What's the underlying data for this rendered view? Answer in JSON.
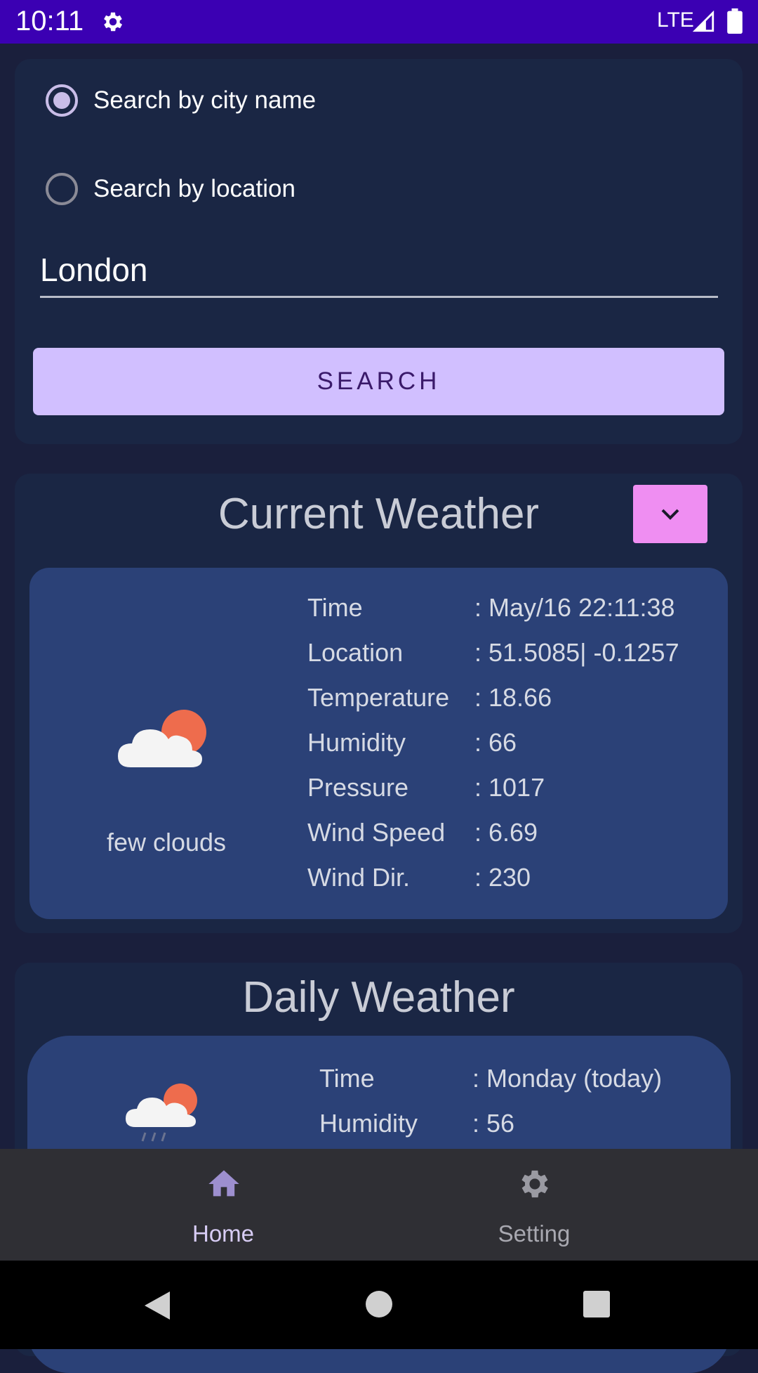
{
  "status_bar": {
    "time": "10:11",
    "network": "LTE",
    "icons": [
      "settings-gear-icon",
      "signal-icon",
      "battery-icon"
    ]
  },
  "search": {
    "options": [
      {
        "label": "Search by city name",
        "checked": true
      },
      {
        "label": "Search by location",
        "checked": false
      }
    ],
    "city_value": "London",
    "button_label": "SEARCH"
  },
  "current_weather": {
    "title": "Current Weather",
    "description": "few clouds",
    "icon": "few-clouds-icon",
    "rows": [
      {
        "key": "Time",
        "value": ":  May/16 22:11:38"
      },
      {
        "key": "Location",
        "value": ": 51.5085| -0.1257"
      },
      {
        "key": "Temperature",
        "value": ": 18.66"
      },
      {
        "key": "Humidity",
        "value": ": 66"
      },
      {
        "key": "Pressure",
        "value": ": 1017"
      },
      {
        "key": "Wind Speed",
        "value": ": 6.69"
      },
      {
        "key": "Wind Dir.",
        "value": ": 230"
      }
    ]
  },
  "daily_weather": {
    "title": "Daily Weather",
    "icon": "rain-clouds-icon",
    "rows": [
      {
        "key": "Time",
        "value": ": Monday (today)"
      },
      {
        "key": "Humidity",
        "value": ": 56"
      }
    ]
  },
  "bottom_nav": {
    "items": [
      {
        "label": "Home",
        "icon": "home-icon",
        "active": true
      },
      {
        "label": "Setting",
        "icon": "gear-icon",
        "active": false
      }
    ]
  },
  "colors": {
    "status_bar": "#3b00b3",
    "background": "#1a1f3c",
    "card": "#1a2644",
    "inner_card": "#2b4177",
    "button": "#d1bfff",
    "collapse_button": "#ef8ef2"
  }
}
